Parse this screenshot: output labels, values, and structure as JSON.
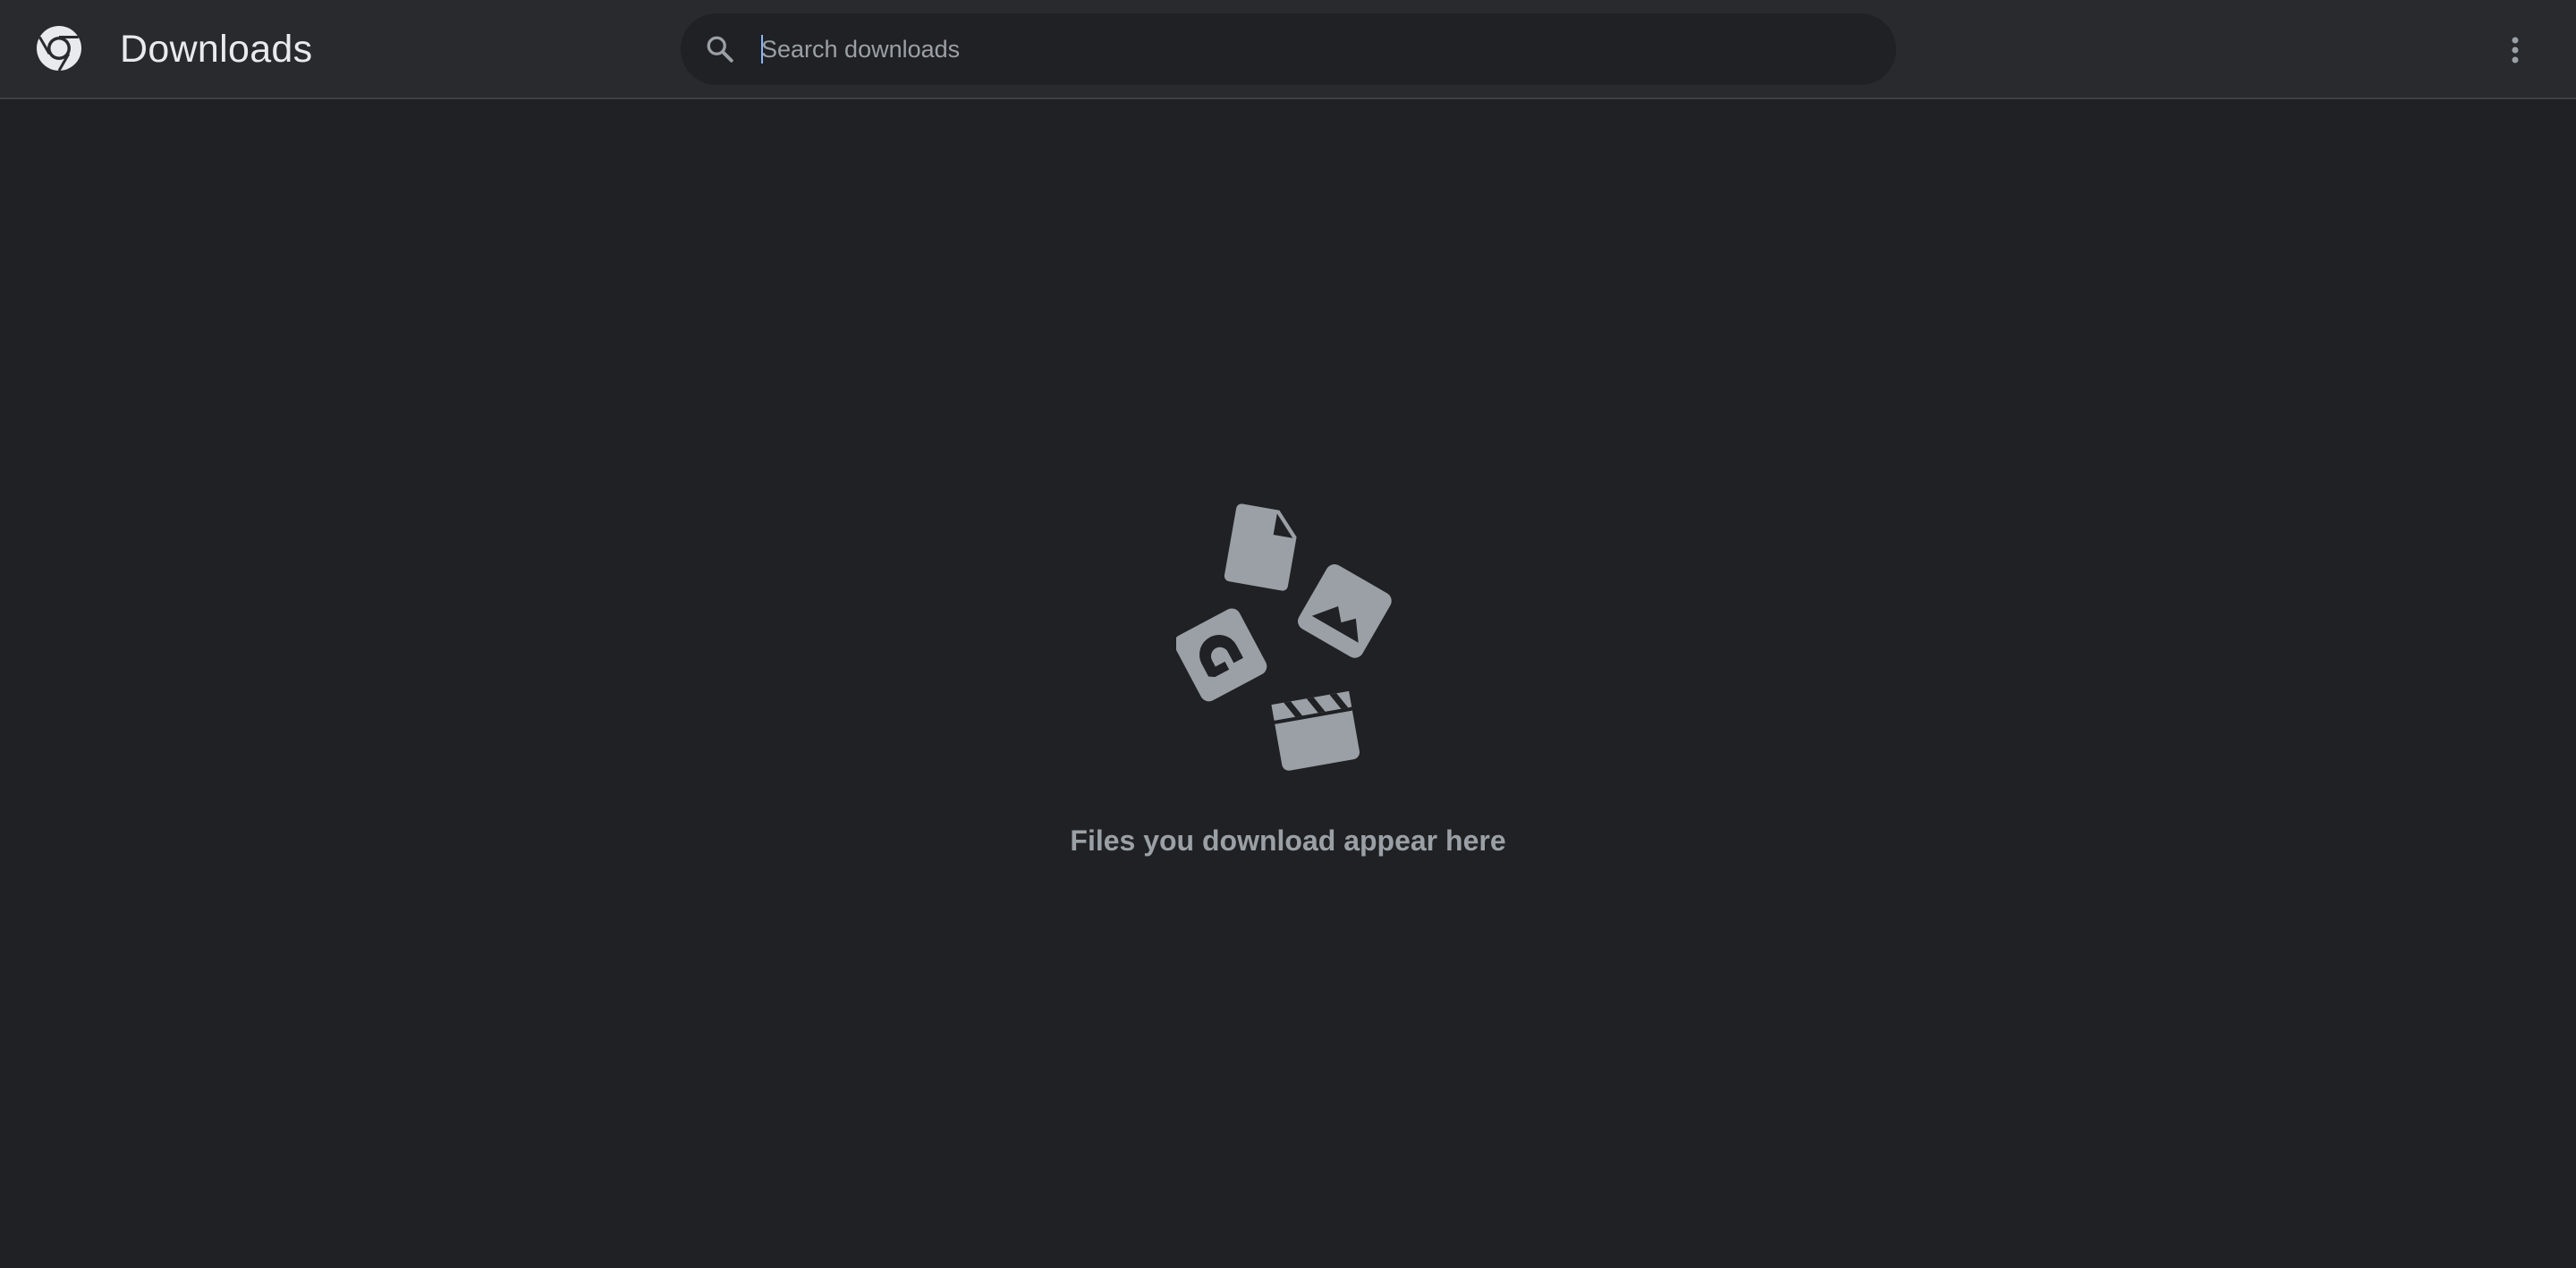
{
  "header": {
    "title": "Downloads",
    "logo_icon": "chrome-logo-icon",
    "menu_icon": "more-vert-icon"
  },
  "search": {
    "placeholder": "Search downloads",
    "value": "",
    "icon": "search-icon"
  },
  "empty_state": {
    "message": "Files you download appear here",
    "icons": [
      "document-icon",
      "image-icon",
      "audio-icon",
      "video-clapper-icon"
    ]
  },
  "colors": {
    "background": "#202124",
    "toolbar": "#292a2d",
    "title_text": "#e8eaed",
    "secondary_text": "#9aa0a6",
    "illustration": "#9aa0a6",
    "caret": "#8ab4f8"
  }
}
